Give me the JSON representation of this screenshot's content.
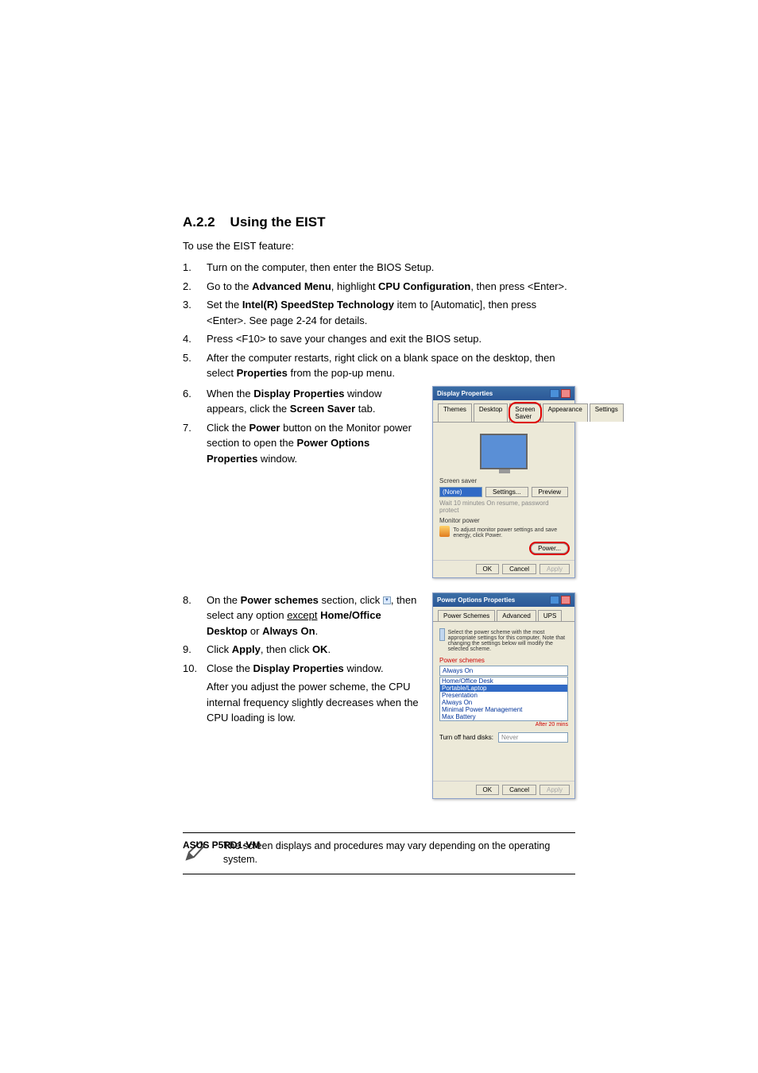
{
  "heading_prefix": "A.2.2",
  "heading_title": "Using the EIST",
  "intro": "To use the EIST feature:",
  "steps_top": [
    {
      "n": "1.",
      "pre": "Turn on the computer, then enter the BIOS Setup."
    },
    {
      "n": "2.",
      "pre": "Go to the ",
      "b1": "Advanced Menu",
      "mid": ", highlight ",
      "b2": "CPU Configuration",
      "post": ", then press <Enter>."
    },
    {
      "n": "3.",
      "pre": "Set the ",
      "b1": "Intel(R) SpeedStep Technology",
      "post": " item to [Automatic], then press <Enter>. See page 2-24 for details."
    },
    {
      "n": "4.",
      "pre": "Press <F10> to save your changes and exit the BIOS setup."
    },
    {
      "n": "5.",
      "pre": "After the computer restarts, right click on a blank space on the desktop, then select ",
      "b1": "Properties",
      "post": " from the pop-up menu."
    }
  ],
  "steps_mid": [
    {
      "n": "6.",
      "pre": "When the ",
      "b1": "Display Properties",
      "mid": " window appears, click the ",
      "b2": "Screen Saver",
      "post": " tab."
    },
    {
      "n": "7.",
      "pre": "Click the ",
      "b1": "Power",
      "mid": " button on the Monitor power section to open the ",
      "b2": "Power Options Properties",
      "post": " window."
    }
  ],
  "steps_bot": [
    {
      "n": "8.",
      "pre": "On the ",
      "b1": "Power schemes",
      "mid": " section, click ",
      "icon": true,
      "mid2": ", then select any option ",
      "u": "except",
      "sp": " ",
      "b2": "Home/Office Desktop",
      "mid3": " or ",
      "b3": "Always On",
      "post": "."
    },
    {
      "n": "9.",
      "pre": "Click ",
      "b1": "Apply",
      "mid": ", then click ",
      "b2": "OK",
      "post": "."
    },
    {
      "n": "10.",
      "pre": "Close the ",
      "b1": "Display Properties",
      "post": " window."
    }
  ],
  "tail_text": "After you adjust the power scheme, the CPU internal frequency slightly decreases when the CPU loading is low.",
  "dlg1": {
    "title": "Display Properties",
    "tabs": [
      "Themes",
      "Desktop",
      "Screen Saver",
      "Appearance",
      "Settings"
    ],
    "ss_label": "Screen saver",
    "ss_value": "(None)",
    "settings_btn": "Settings...",
    "preview_btn": "Preview",
    "wait_row": "Wait   10   minutes   On resume, password protect",
    "mp_label": "Monitor power",
    "mp_desc": "To adjust monitor power settings and save energy, click Power.",
    "power_btn": "Power...",
    "ok": "OK",
    "cancel": "Cancel",
    "apply": "Apply"
  },
  "dlg2": {
    "title": "Power Options Properties",
    "tabs": [
      "Power Schemes",
      "Advanced",
      "UPS"
    ],
    "desc": "Select the power scheme with the most appropriate settings for this computer. Note that changing the settings below will modify the selected scheme.",
    "ps_label": "Power schemes",
    "ps_value": "Always On",
    "ps_options": [
      "Home/Office Desk",
      "Portable/Laptop",
      "Presentation",
      "Always On",
      "Minimal Power Management",
      "Max Battery"
    ],
    "turnoff_label": "Turn off hard disks:",
    "turnoff_value": "Never",
    "after_label": "After 20 mins",
    "ok": "OK",
    "cancel": "Cancel",
    "apply": "Apply"
  },
  "note": "The screen displays and procedures may vary depending on the operating system.",
  "footer": "ASUS P5RD1-VM"
}
